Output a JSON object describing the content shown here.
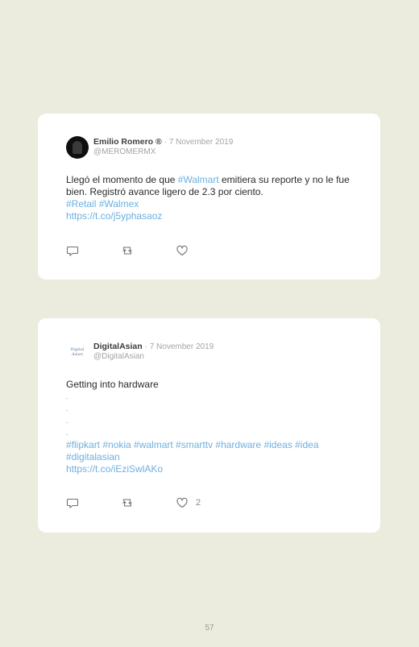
{
  "tweets": [
    {
      "author": "Emilio Romero ®",
      "date": "· 7 November 2019",
      "handle": "@MEROMERMX",
      "text": "Llegó el momento de que ",
      "hashtag_inline": "#Walmart",
      "text_after": " emitiera su reporte y no le fue bien. Registró avance ligero de 2.3 por ciento.",
      "hashtags": "#Retail #Walmex",
      "url": "https://t.co/j5yphasaoz",
      "like_count": ""
    },
    {
      "author": "DigitalAsian",
      "date": "· 7 November 2019",
      "handle": "@DigitalAsian",
      "avatar_text": [
        "Digital",
        "Asian"
      ],
      "text": "Getting into hardware",
      "dots": [
        ".",
        ".",
        ".",
        "."
      ],
      "hashtags": "#flipkart #nokia #walmart #smarttv #hardware #ideas #idea #digitalasian",
      "url": "https://t.co/iEziSwlAKo",
      "like_count": "2"
    }
  ],
  "icons": {
    "reply": "reply-icon",
    "retweet": "retweet-icon",
    "like": "heart-icon"
  },
  "page_number": "57"
}
